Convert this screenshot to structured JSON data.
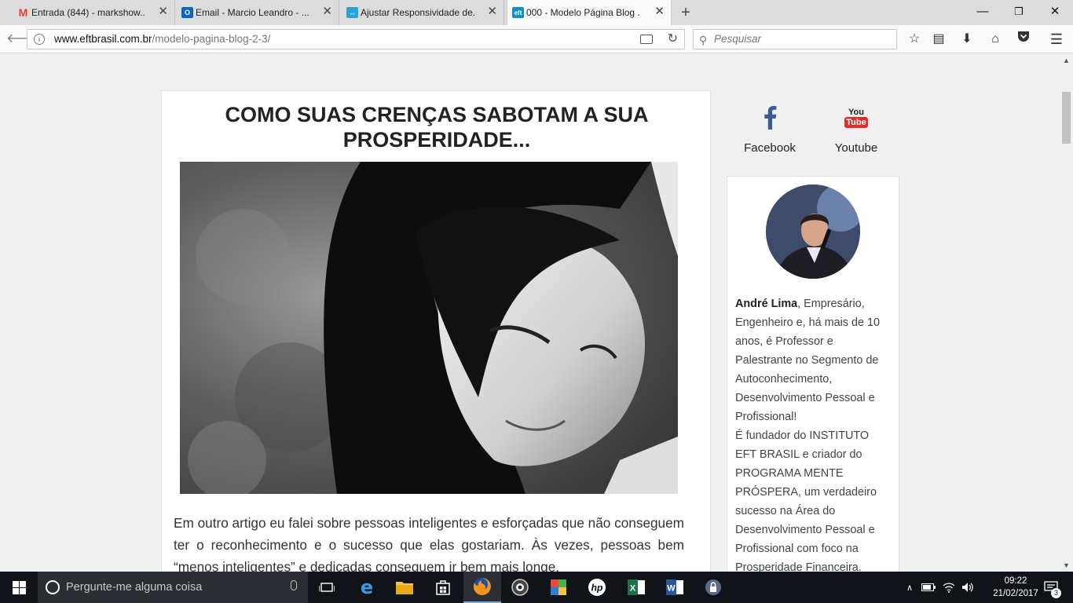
{
  "browser": {
    "tabs": [
      {
        "title": "Entrada (844) - markshow...",
        "favicon": "gmail-icon",
        "color": "#d44638",
        "glyph": "M"
      },
      {
        "title": "Email - Marcio Leandro - ...",
        "favicon": "outlook-icon",
        "color": "#0a64c8",
        "glyph": "O"
      },
      {
        "title": "Ajustar Responsividade de...",
        "favicon": "site-icon",
        "color": "#27a3d9",
        "glyph": "↔"
      },
      {
        "title": "000 - Modelo Página Blog ...",
        "favicon": "eft-icon",
        "color": "#0e8fcf",
        "glyph": "eft"
      }
    ],
    "new_tab_label": "+",
    "url_host": "www.eftbrasil.com.br",
    "url_path": "/modelo-pagina-blog-2-3/",
    "search_placeholder": "Pesquisar",
    "window_controls": [
      "minimize",
      "restore",
      "close"
    ]
  },
  "page": {
    "post_title": "COMO SUAS CRENÇAS SABOTAM A SUA PROSPERIDADE...",
    "post_body": "Em outro artigo eu falei sobre pessoas inteligentes e esforçadas que não conseguem ter o reconhecimento e o sucesso que elas gostariam. Às vezes, pessoas bem “menos inteligentes” e dedicadas conseguem ir bem mais longe.",
    "social": {
      "facebook_label": "Facebook",
      "youtube_label": "Youtube",
      "youtube_logo_top": "You",
      "youtube_logo_bottom": "Tube"
    },
    "bio": {
      "name": "André Lima",
      "text1": ", Empresário, Engenheiro e, há mais de 10 anos, é Professor e Palestrante no Segmento de Autoconhecimento, Desenvolvimento Pessoal e Profissional!",
      "text2": "É fundador do INSTITUTO EFT BRASIL e criador do PROGRAMA MENTE PRÓSPERA, um verdadeiro sucesso na Área do Desenvolvimento Pessoal e Profissional com foco na Prosperidade Financeira."
    }
  },
  "taskbar": {
    "search_placeholder": "Pergunte-me alguma coisa",
    "time": "09:22",
    "date": "21/02/2017",
    "notification_count": "3"
  }
}
